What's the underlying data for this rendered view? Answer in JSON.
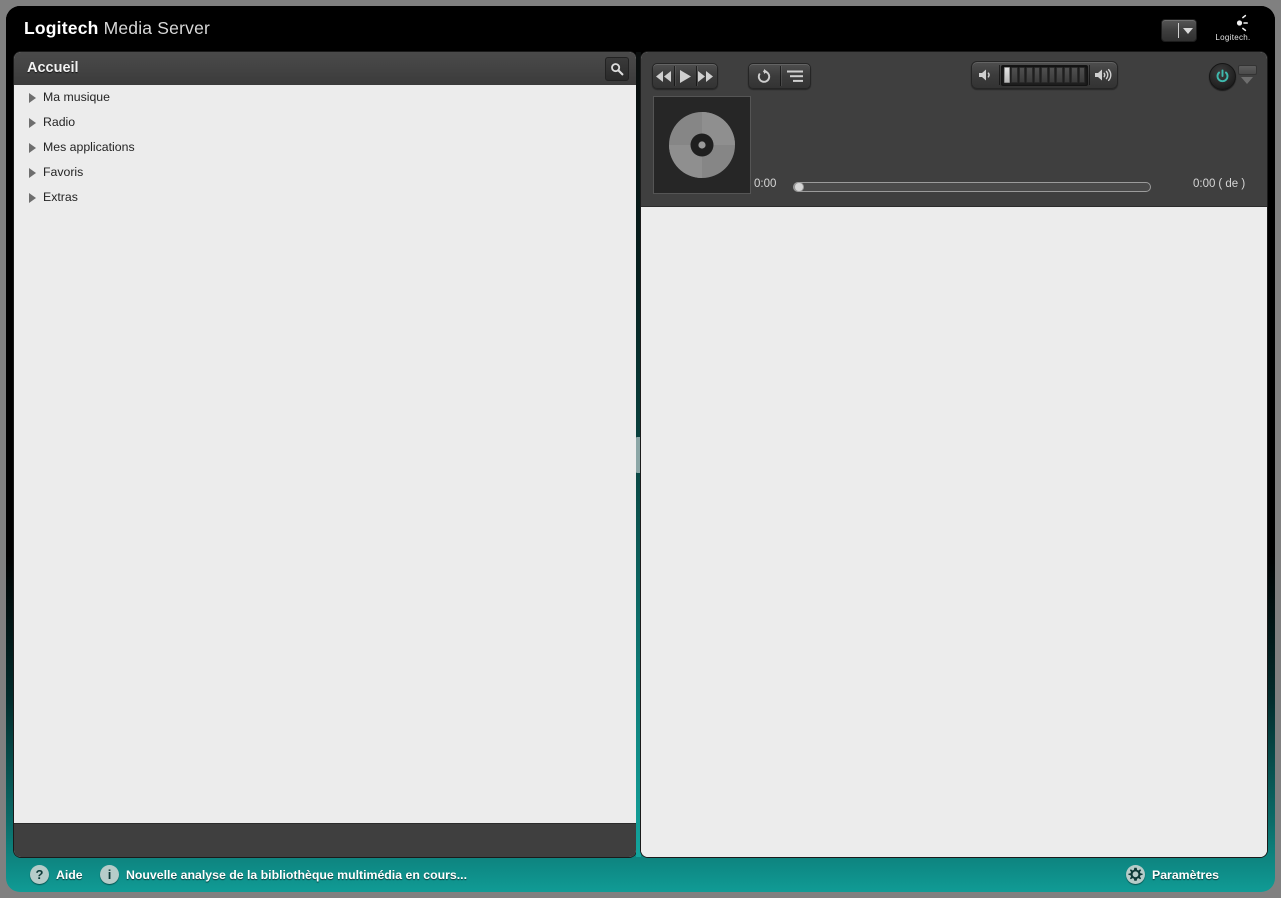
{
  "window": {
    "title_brand": "Logitech",
    "title_suffix": "Media Server",
    "logo_word": "Logitech."
  },
  "sidebar": {
    "header_title": "Accueil",
    "search_icon": "search-icon",
    "items": [
      {
        "label": "Ma musique"
      },
      {
        "label": "Radio"
      },
      {
        "label": "Mes applications"
      },
      {
        "label": "Favoris"
      },
      {
        "label": "Extras"
      }
    ]
  },
  "player": {
    "transport": {
      "rewind": "rewind-icon",
      "play": "play-icon",
      "forward": "fast-forward-icon"
    },
    "modes": {
      "repeat": "repeat-icon",
      "shuffle": "shuffle-icon"
    },
    "volume": {
      "down_icon": "volume-down-icon",
      "up_icon": "volume-up-icon",
      "segments_total": 11,
      "segments_on": 1
    },
    "power_icon": "power-icon",
    "player_select_icon": "player-select-icon",
    "artwork_icon": "compact-disc-icon",
    "elapsed_time": "0:00",
    "total_time": "0:00",
    "total_time_of": "( de )",
    "progress_percent": 0
  },
  "statusbar": {
    "help_label": "Aide",
    "help_icon": "question-mark-icon",
    "scan_message": "Nouvelle analyse de la bibliothèque multimédia en cours...",
    "scan_icon": "info-icon",
    "settings_label": "Paramètres",
    "settings_icon": "gear-icon"
  },
  "colors": {
    "accent_teal": "#109b95",
    "panel_bg": "#ececec",
    "header_bg": "#3f3f3f",
    "power_on": "#3fb9ad"
  }
}
